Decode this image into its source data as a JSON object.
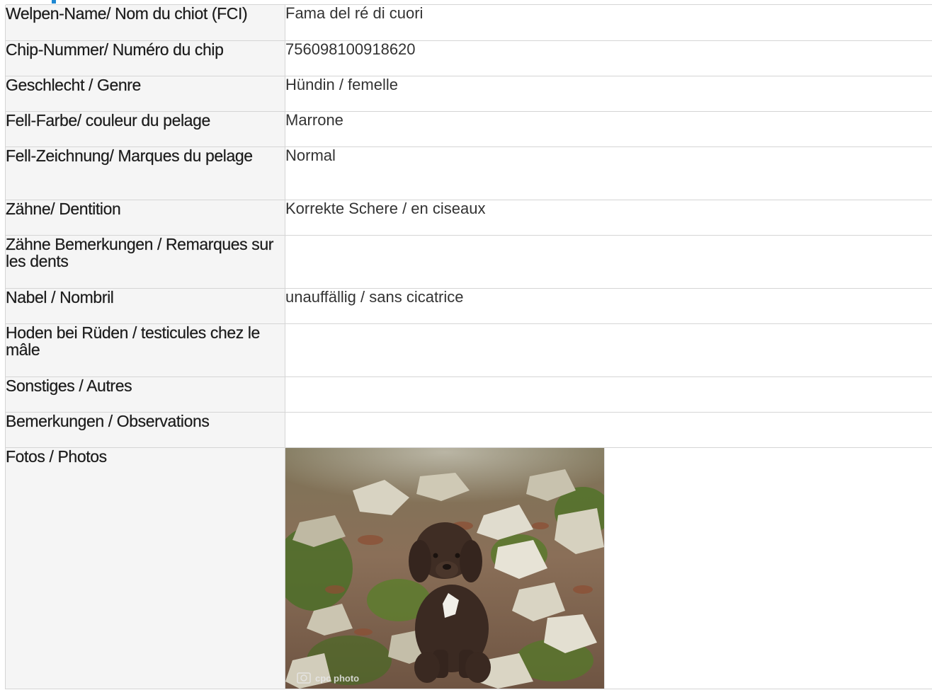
{
  "rows": [
    {
      "label": "Welpen-Name/ Nom du chiot (FCI)",
      "value": "Fama del ré di cuori"
    },
    {
      "label": "Chip-Nummer/ Numéro du chip",
      "value": "756098100918620"
    },
    {
      "label": "Geschlecht / Genre",
      "value": "Hündin / femelle"
    },
    {
      "label": "Fell-Farbe/ couleur du pelage",
      "value": "Marrone"
    },
    {
      "label": "Fell-Zeichnung/ Marques du pelage",
      "value": "Normal"
    },
    {
      "label": "Zähne/ Dentition",
      "value": "Korrekte Schere / en ciseaux"
    },
    {
      "label": "Zähne Bemerkungen / Remarques sur les dents",
      "value": ""
    },
    {
      "label": "Nabel / Nombril",
      "value": "unauffällig / sans cicatrice"
    },
    {
      "label": "Hoden bei Rüden / testicules chez le mâle",
      "value": ""
    },
    {
      "label": "Sonstiges / Autres",
      "value": ""
    },
    {
      "label": "Bemerkungen / Observations",
      "value": ""
    }
  ],
  "photos": {
    "label": "Fotos / Photos",
    "watermark": "cpc photo"
  },
  "colors": {
    "accent": "#1e88d2",
    "label_bg": "#f5f5f5",
    "border": "#d5d5d5"
  }
}
